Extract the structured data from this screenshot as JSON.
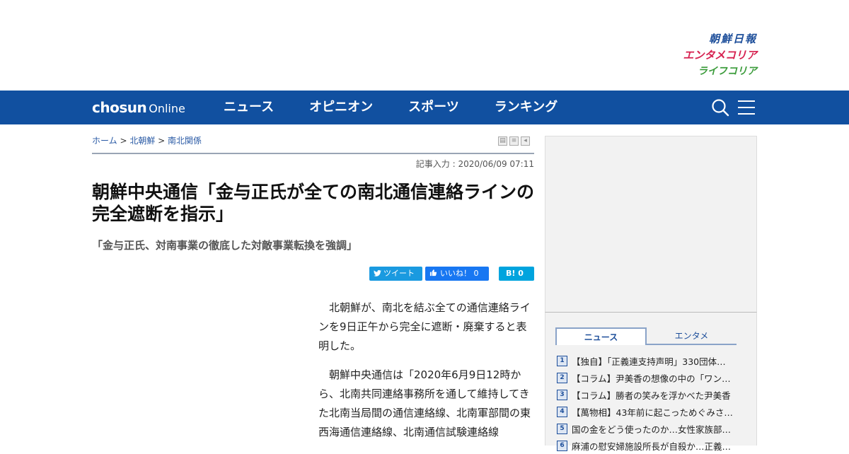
{
  "brands": {
    "chosun": "朝鮮日報",
    "entakorea": "エンタメコリア",
    "lifekorea": "ライフコリア"
  },
  "nav": {
    "logo_main": "chosun",
    "logo_sub": "Online",
    "items": [
      "ニュース",
      "オピニオン",
      "スポーツ",
      "ランキング"
    ]
  },
  "breadcrumb": {
    "home": "ホーム",
    "sep": " > ",
    "section": "北朝鮮",
    "subsection": "南北関係"
  },
  "article": {
    "date": "記事入力 : 2020/06/09 07:11",
    "headline": "朝鮮中央通信「金与正氏が全ての南北通信連絡ラインの完全遮断を指示」",
    "subhead": "「金与正氏、対南事業の徹底した対敵事業転換を強調」",
    "paragraphs": [
      "北朝鮮が、南北を結ぶ全ての通信連絡ラインを9日正午から完全に遮断・廃棄すると表明した。",
      "朝鮮中央通信は「2020年6月9日12時から、北南共同連絡事務所を通して維持してきた北南当局間の通信連絡線、北南軍部間の東西海通信連絡線、北南通信試験連絡線"
    ]
  },
  "share": {
    "tweet": "ツイート",
    "like": "いいね！ 0",
    "hatena": "B! 0"
  },
  "sidebar": {
    "tabs": [
      "ニュース",
      "エンタメ"
    ],
    "ranking": [
      {
        "num": "1",
        "title": "【独自】「正義連支持声明」330団体…"
      },
      {
        "num": "2",
        "title": "【コラム】尹美香の想像の中の「ワン…"
      },
      {
        "num": "3",
        "title": "【コラム】勝者の笑みを浮かべた尹美香"
      },
      {
        "num": "4",
        "title": "【萬物相】43年前に起こっためぐみさ…"
      },
      {
        "num": "5",
        "title": "国の金をどう使ったのか…女性家族部…"
      },
      {
        "num": "6",
        "title": "麻浦の慰安婦施設所長が自殺か…正義…"
      }
    ]
  },
  "colors": {
    "nav_bg": "#1150a0",
    "link": "#2a5aa5",
    "brand_chosun": "#1d4e9a",
    "brand_enta": "#d6204f",
    "brand_life": "#3a9b3a"
  }
}
